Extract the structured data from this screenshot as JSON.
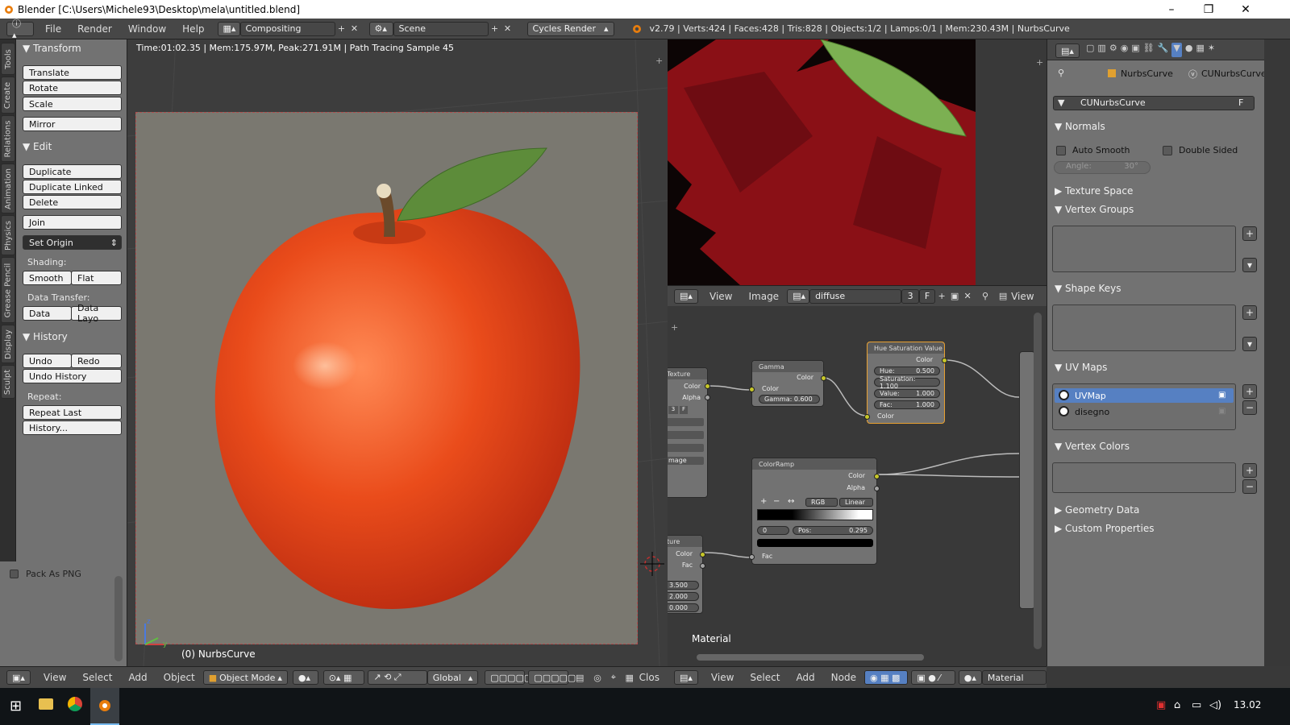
{
  "window": {
    "title": "Blender [C:\\Users\\Michele93\\Desktop\\mela\\untitled.blend]",
    "minimize": "–",
    "maximize": "❐",
    "close": "✕"
  },
  "topbar": {
    "menus": [
      "File",
      "Render",
      "Window",
      "Help"
    ],
    "screen_layout": "Compositing",
    "scene": "Scene",
    "render_engine": "Cycles Render",
    "stats": "v2.79 | Verts:424 | Faces:428 | Tris:828 | Objects:1/2 | Lamps:0/1 | Mem:230.43M | NurbsCurve"
  },
  "tool_tabs": [
    "Tools",
    "Create",
    "Relations",
    "Animation",
    "Physics",
    "Grease Pencil",
    "Display",
    "Sculpt"
  ],
  "toolshelf": {
    "transform": {
      "title": "Transform",
      "buttons": [
        "Translate",
        "Rotate",
        "Scale",
        "Mirror"
      ]
    },
    "edit": {
      "title": "Edit",
      "buttons": [
        "Duplicate",
        "Duplicate Linked",
        "Delete",
        "Join"
      ],
      "set_origin": "Set Origin"
    },
    "shading": {
      "label": "Shading:",
      "smooth": "Smooth",
      "flat": "Flat"
    },
    "data_transfer": {
      "label": "Data Transfer:",
      "data": "Data",
      "data_layo": "Data Layo"
    },
    "history": {
      "title": "History",
      "undo": "Undo",
      "redo": "Redo",
      "undo_history": "Undo History",
      "repeat_label": "Repeat:",
      "repeat_last": "Repeat Last",
      "history_btn": "History..."
    },
    "pack_as_png": "Pack As PNG"
  },
  "viewport": {
    "render_info": "Time:01:02.35 | Mem:175.97M, Peak:271.91M | Path Tracing Sample 45",
    "object_label": "(0) NurbsCurve",
    "axis_z": "z",
    "axis_y": "y",
    "header": {
      "menus": [
        "View",
        "Select",
        "Add",
        "Object"
      ],
      "mode": "Object Mode",
      "orientation": "Global",
      "clos": "Clos"
    }
  },
  "image_editor": {
    "header": {
      "view": "View",
      "image": "Image",
      "image_name": "diffuse",
      "users": "3",
      "fake": "F",
      "view2": "View"
    }
  },
  "node_editor": {
    "nodes": {
      "texture": {
        "title": "Texture",
        "out_color": "Color",
        "out_alpha": "Alpha",
        "select_value": "mage",
        "fields": [
          "3",
          "F"
        ]
      },
      "gamma": {
        "title": "Gamma",
        "out_color": "Color",
        "in_color": "Color",
        "gamma": "Gamma: 0.600"
      },
      "hsv": {
        "title": "Hue Saturation Value",
        "out_color": "Color",
        "hue_label": "Hue:",
        "hue_value": "0.500",
        "sat_label": "Saturation: 1.100",
        "val_label": "Value:",
        "val_value": "1.000",
        "fac_label": "Fac:",
        "fac_value": "1.000",
        "in_color": "Color"
      },
      "colorramp": {
        "title": "ColorRamp",
        "out_color": "Color",
        "out_alpha": "Alpha",
        "mode": "RGB",
        "interp": "Linear",
        "index": "0",
        "pos": "Pos:",
        "pos_value": "0.295",
        "in_fac": "Fac"
      },
      "texture2": {
        "title": "ture",
        "out_color": "Color",
        "out_fac": "Fac",
        "v1": "3.500",
        "v2": "2.000",
        "v3": "0.000"
      }
    },
    "material_label": "Material",
    "header": {
      "menus": [
        "View",
        "Select",
        "Add",
        "Node"
      ],
      "material": "Material"
    }
  },
  "properties": {
    "breadcrumb_object": "NurbsCurve",
    "breadcrumb_data": "CUNurbsCurve",
    "datablock": "CUNurbsCurve",
    "fake": "F",
    "normals": {
      "title": "Normals",
      "auto_smooth": "Auto Smooth",
      "double_sided": "Double Sided",
      "angle_label": "Angle:",
      "angle_value": "30°"
    },
    "panels": {
      "texture_space": "Texture Space",
      "vertex_groups": "Vertex Groups",
      "shape_keys": "Shape Keys",
      "uv_maps": "UV Maps",
      "vertex_colors": "Vertex Colors",
      "geometry_data": "Geometry Data",
      "custom_properties": "Custom Properties"
    },
    "uv_maps": [
      "UVMap",
      "disegno"
    ]
  },
  "taskbar": {
    "time": "13.02"
  },
  "colors": {
    "accent": "#5680c2",
    "panel": "#727272",
    "viewport_bg": "#3d3d3d",
    "header": "#474747"
  }
}
